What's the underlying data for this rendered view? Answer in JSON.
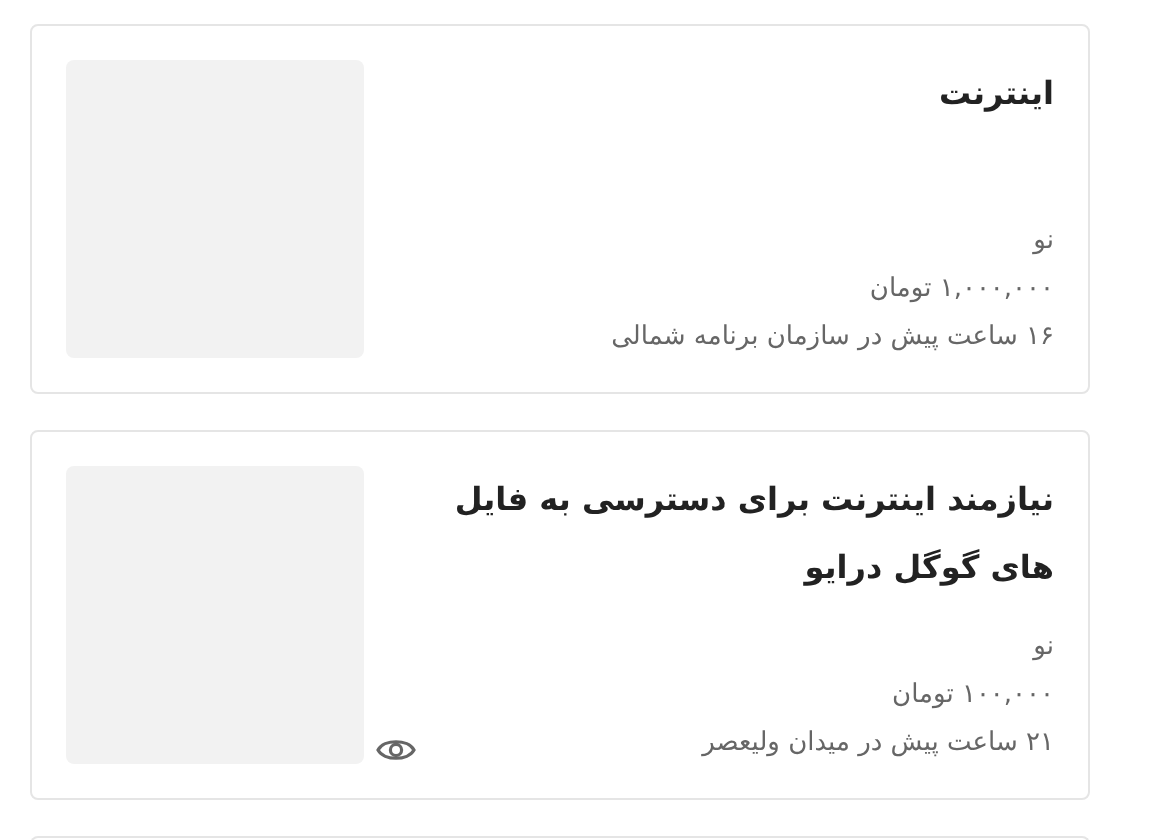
{
  "listings": [
    {
      "title": "اینترنت",
      "condition": "نو",
      "price": "۱,۰۰۰,۰۰۰ تومان",
      "meta": "۱۶ ساعت پیش در سازمان برنامه شمالی",
      "seen": false
    },
    {
      "title": "نیازمند اینترنت برای دسترسی به فایل های گوگل درایو",
      "condition": "نو",
      "price": "۱۰۰,۰۰۰ تومان",
      "meta": "۲۱ ساعت پیش در میدان ولیعصر",
      "seen": true
    }
  ]
}
